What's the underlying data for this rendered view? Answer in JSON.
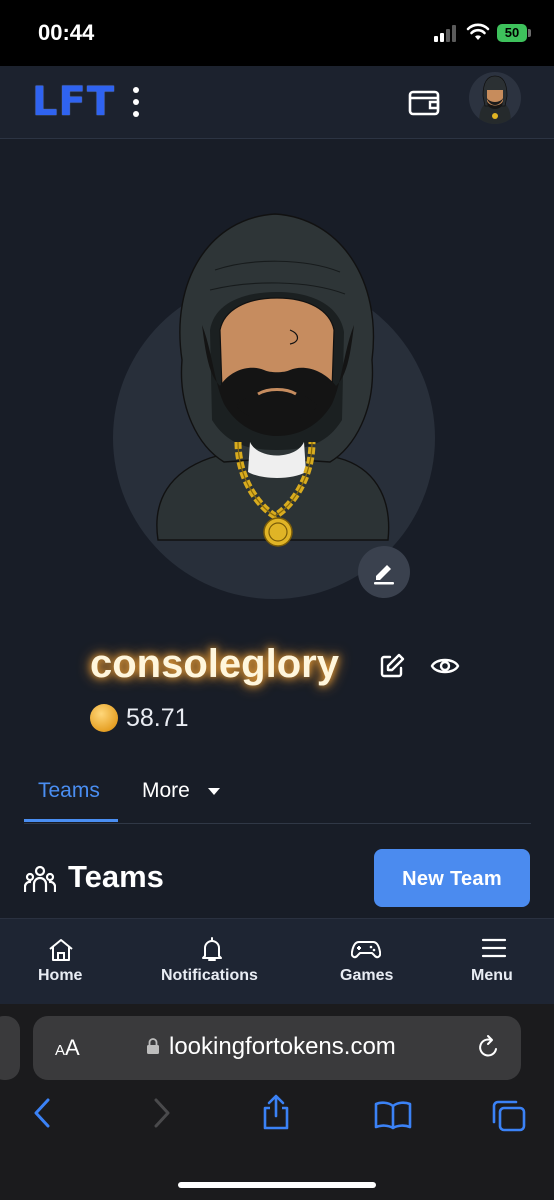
{
  "status_bar": {
    "time": "00:44",
    "battery": "50"
  },
  "header": {
    "logo": "LFT",
    "menu_icon": "kebab-icon",
    "wallet_icon": "wallet-icon",
    "avatar_icon": "avatar-icon"
  },
  "profile": {
    "username": "consoleglory",
    "balance": "58.71",
    "edit_avatar_icon": "pencil-icon",
    "edit_name_icon": "edit-icon",
    "visibility_icon": "eye-icon",
    "coin_icon": "coin-icon"
  },
  "tabs": [
    {
      "label": "Teams",
      "active": true
    },
    {
      "label": "More",
      "active": false
    }
  ],
  "teams_section": {
    "title": "Teams",
    "new_team_label": "New Team",
    "icon": "people-icon"
  },
  "bottom_nav": [
    {
      "label": "Home",
      "icon": "home-icon"
    },
    {
      "label": "Notifications",
      "icon": "bell-icon"
    },
    {
      "label": "Games",
      "icon": "gamepad-icon"
    },
    {
      "label": "Menu",
      "icon": "menu-icon"
    }
  ],
  "browser": {
    "aa_label": "AA",
    "url": "lookingfortokens.com",
    "toolbar": [
      "back-icon",
      "forward-icon",
      "share-icon",
      "bookmarks-icon",
      "tabs-icon"
    ]
  },
  "colors": {
    "background": "#181d27",
    "accent": "#4b8bef",
    "username_glow": "#f2a43a",
    "logo": "#2f63f0"
  }
}
